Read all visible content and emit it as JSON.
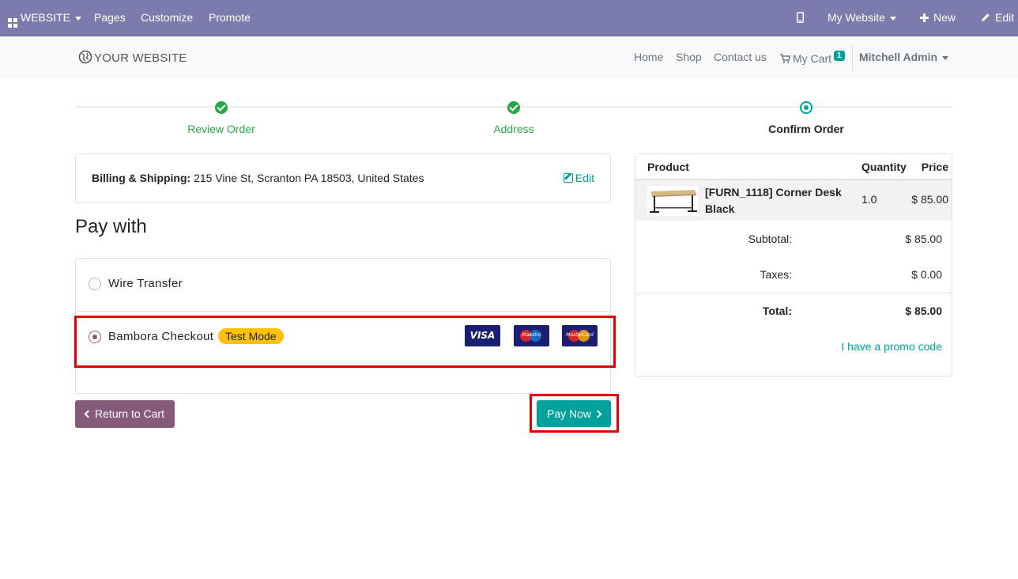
{
  "admin_bar": {
    "website_menu": "WEBSITE",
    "pages": "Pages",
    "customize": "Customize",
    "promote": "Promote",
    "my_website": "My Website",
    "new": "New",
    "edit": "Edit",
    "bg_color": "#7c7bad"
  },
  "site_header": {
    "logo_text": "YOUR WEBSITE",
    "nav": {
      "home": "Home",
      "shop": "Shop",
      "contact": "Contact us",
      "cart": "My Cart",
      "cart_count": "1",
      "user": "Mitchell Admin"
    }
  },
  "wizard": {
    "steps": [
      {
        "label": "Review Order",
        "status": "done"
      },
      {
        "label": "Address",
        "status": "done"
      },
      {
        "label": "Confirm Order",
        "status": "current"
      }
    ]
  },
  "billing": {
    "label": "Billing & Shipping:",
    "address": "215 Vine St, Scranton PA 18503, United States",
    "edit": "Edit"
  },
  "payment": {
    "heading": "Pay with",
    "methods": [
      {
        "label": "Wire Transfer",
        "selected": false
      },
      {
        "label": "Bambora Checkout",
        "selected": true,
        "badge": "Test Mode",
        "cards": [
          "VISA",
          "Maestro",
          "MasterCard"
        ]
      }
    ]
  },
  "actions": {
    "return_to_cart": "Return to Cart",
    "pay_now": "Pay Now"
  },
  "summary": {
    "headers": {
      "product": "Product",
      "quantity": "Quantity",
      "price": "Price"
    },
    "items": [
      {
        "name": "[FURN_1118] Corner Desk Black",
        "quantity": "1.0",
        "price": "$ 85.00"
      }
    ],
    "subtotal_label": "Subtotal:",
    "subtotal": "$ 85.00",
    "taxes_label": "Taxes:",
    "taxes": "$ 0.00",
    "total_label": "Total:",
    "total": "$ 85.00",
    "promo": "I have a promo code"
  },
  "colors": {
    "primary": "#00a09d",
    "secondary": "#875a7b",
    "success": "#28a745",
    "highlight": "#e30000"
  }
}
